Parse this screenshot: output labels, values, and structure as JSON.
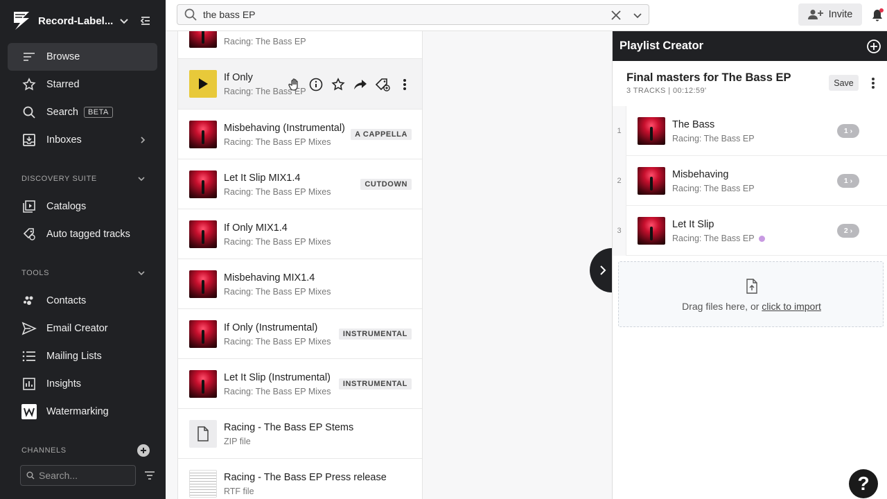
{
  "brand": {
    "name": "Record-Label..."
  },
  "sidebar": {
    "nav": [
      {
        "label": "Browse",
        "icon": "browse-icon"
      },
      {
        "label": "Starred",
        "icon": "star-icon"
      },
      {
        "label": "Search",
        "icon": "search-icon",
        "badge": "BETA"
      },
      {
        "label": "Inboxes",
        "icon": "inbox-icon"
      }
    ],
    "discovery": {
      "title": "DISCOVERY SUITE",
      "items": [
        {
          "label": "Catalogs",
          "icon": "catalog-icon"
        },
        {
          "label": "Auto tagged tracks",
          "icon": "auto-tag-icon"
        }
      ]
    },
    "tools": {
      "title": "TOOLS",
      "items": [
        {
          "label": "Contacts",
          "icon": "contacts-icon"
        },
        {
          "label": "Email Creator",
          "icon": "send-icon"
        },
        {
          "label": "Mailing Lists",
          "icon": "list-icon"
        },
        {
          "label": "Insights",
          "icon": "chart-icon"
        },
        {
          "label": "Watermarking",
          "icon": "watermark-icon"
        }
      ]
    },
    "channels": {
      "title": "CHANNELS",
      "search_placeholder": "Search..."
    }
  },
  "topbar": {
    "search_value": "the bass EP",
    "invite_label": "Invite"
  },
  "tracks": [
    {
      "title": "",
      "subtitle": "Racing: The Bass EP",
      "tag": ""
    },
    {
      "title": "If Only",
      "subtitle": "Racing: The Bass EP",
      "tag": ""
    },
    {
      "title": "Misbehaving (Instrumental)",
      "subtitle": "Racing: The Bass EP Mixes",
      "tag": "A CAPPELLA"
    },
    {
      "title": "Let It Slip MIX1.4",
      "subtitle": "Racing: The Bass EP Mixes",
      "tag": "CUTDOWN"
    },
    {
      "title": "If Only MIX1.4",
      "subtitle": "Racing: The Bass EP Mixes",
      "tag": ""
    },
    {
      "title": "Misbehaving MIX1.4",
      "subtitle": "Racing: The Bass EP Mixes",
      "tag": ""
    },
    {
      "title": "If Only (Instrumental)",
      "subtitle": "Racing: The Bass EP Mixes",
      "tag": "INSTRUMENTAL"
    },
    {
      "title": "Let It Slip (Instrumental)",
      "subtitle": "Racing: The Bass EP Mixes",
      "tag": "INSTRUMENTAL"
    },
    {
      "title": "Racing - The Bass EP Stems",
      "subtitle": "ZIP file",
      "tag": ""
    },
    {
      "title": "Racing - The Bass EP Press release",
      "subtitle": "RTF file",
      "tag": ""
    }
  ],
  "panel": {
    "title": "Playlist Creator",
    "playlist_name": "Final masters for The Bass EP",
    "meta": "3 TRACKS | 00:12:59'",
    "save_label": "Save",
    "items": [
      {
        "num": "1",
        "title": "The Bass",
        "subtitle": "Racing: The Bass EP",
        "versions": "1"
      },
      {
        "num": "2",
        "title": "Misbehaving",
        "subtitle": "Racing: The Bass EP",
        "versions": "1"
      },
      {
        "num": "3",
        "title": "Let It Slip",
        "subtitle": "Racing: The Bass EP",
        "versions": "2"
      }
    ],
    "dropzone_text": "Drag files here, or ",
    "dropzone_link": "click to import"
  },
  "help_label": "?",
  "colors": {
    "sidebar_bg": "#202124",
    "accent_play": "#e8c93a",
    "dot": "#c89ae2"
  }
}
